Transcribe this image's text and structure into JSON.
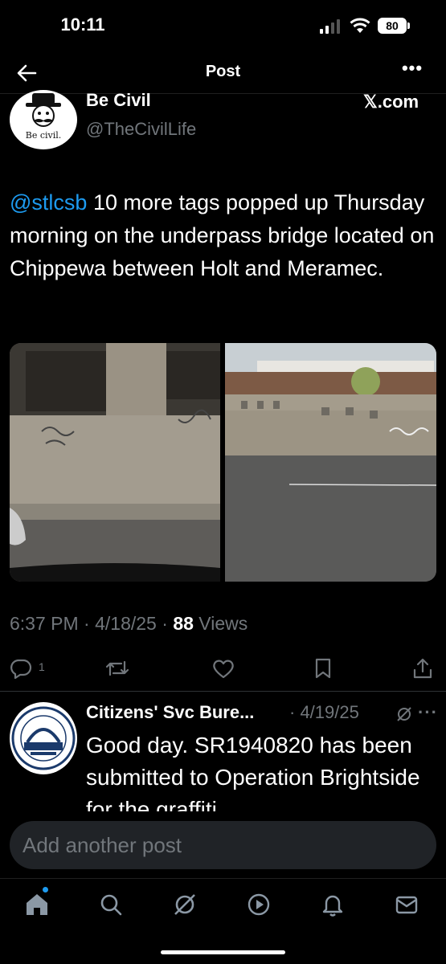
{
  "status_bar": {
    "time": "10:11",
    "battery": "80"
  },
  "header": {
    "title": "Post",
    "more": "•••"
  },
  "author": {
    "name": "Be Civil",
    "handle": "@TheCivilLife",
    "avatar_caption": "Be civil.",
    "source": "𝕏.com"
  },
  "tweet": {
    "mention": "@stlcsb",
    "text": " 10 more tags popped up Thursday morning on the underpass bridge located on Chippewa between Holt and Meramec.",
    "time": "6:37 PM",
    "sep1": " · ",
    "date": "4/18/25",
    "sep2": " · ",
    "views_count": "88",
    "views_label": " Views"
  },
  "actions": {
    "reply_count": "1"
  },
  "reply": {
    "name": "Citizens' Svc Bure...",
    "date": "· 4/19/25",
    "more": "···",
    "text": "Good day.  SR1940820 has been submitted to Operation Brightside for the graffiti"
  },
  "compose": {
    "placeholder": "Add another post"
  },
  "colors": {
    "accent": "#1d9bf0",
    "background": "#000000",
    "muted": "#71767b"
  }
}
